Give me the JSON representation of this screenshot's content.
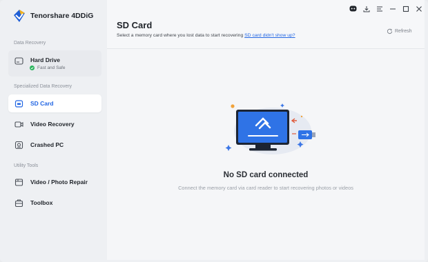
{
  "app": {
    "name": "Tenorshare 4DDiG",
    "accent": "#2266e3"
  },
  "sidebar": {
    "sections": [
      {
        "label": "Data Recovery"
      },
      {
        "label": "Specialized Data Recovery"
      },
      {
        "label": "Utility Tools"
      }
    ],
    "items": [
      {
        "label": "Hard Drive",
        "status": "Fast and Safe",
        "icon": "hard-drive-icon"
      },
      {
        "label": "SD Card",
        "icon": "sd-card-icon",
        "active": true
      },
      {
        "label": "Video Recovery",
        "icon": "video-icon"
      },
      {
        "label": "Crashed PC",
        "icon": "crashed-pc-icon"
      },
      {
        "label": "Video / Photo Repair",
        "icon": "repair-icon"
      },
      {
        "label": "Toolbox",
        "icon": "toolbox-icon"
      }
    ]
  },
  "header": {
    "title": "SD Card",
    "subtitle": "Select a memory card where you lost data to start recovering",
    "link": "SD card didn't show up?",
    "refresh": "Refresh"
  },
  "window_controls": [
    "discord-icon",
    "download-icon",
    "menu-icon",
    "minimize-icon",
    "maximize-icon",
    "close-icon"
  ],
  "empty_state": {
    "title": "No SD card connected",
    "description": "Connect the memory card via card reader to start recovering photos or videos"
  }
}
